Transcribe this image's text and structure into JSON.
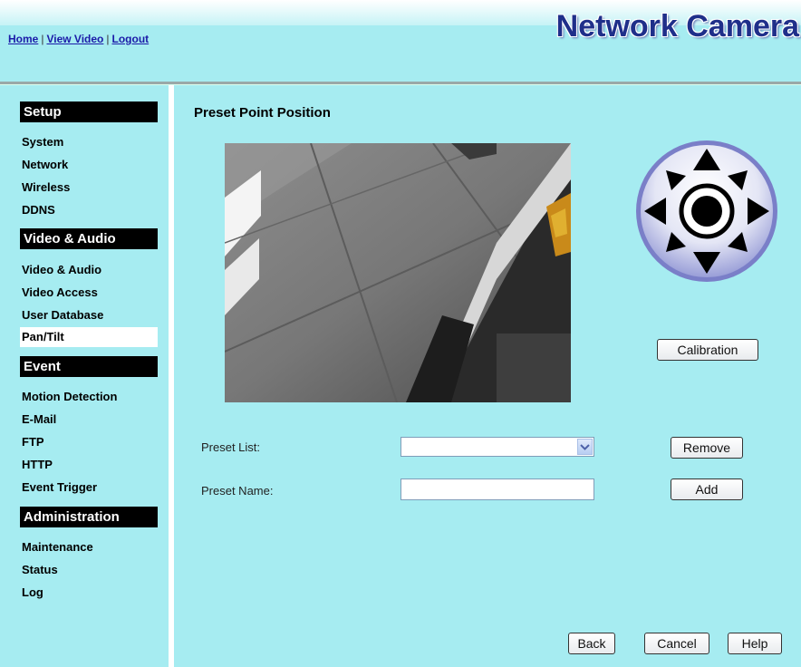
{
  "nav_links": {
    "home": "Home",
    "view_video": "View Video",
    "logout": "Logout",
    "separator": "|"
  },
  "brand": "Network Camera",
  "sidebar": {
    "sections": [
      {
        "title": "Setup",
        "items": [
          "System",
          "Network",
          "Wireless",
          "DDNS"
        ]
      },
      {
        "title": "Video & Audio",
        "items": [
          "Video & Audio",
          "Video Access",
          "User Database",
          "Pan/Tilt"
        ]
      },
      {
        "title": "Event",
        "items": [
          "Motion Detection",
          "E-Mail",
          "FTP",
          "HTTP",
          "Event Trigger"
        ]
      },
      {
        "title": "Administration",
        "items": [
          "Maintenance",
          "Status",
          "Log"
        ]
      }
    ],
    "active_item": "Pan/Tilt"
  },
  "main": {
    "title": "Preset Point Position",
    "calibration_button": "Calibration",
    "preset_list_label": "Preset List:",
    "preset_list_value": "",
    "remove_button": "Remove",
    "preset_name_label": "Preset Name:",
    "preset_name_value": "",
    "add_button": "Add"
  },
  "footer_buttons": {
    "back": "Back",
    "cancel": "Cancel",
    "help": "Help"
  },
  "colors": {
    "background": "#a6ecf1",
    "brand": "#1f2f8a",
    "link": "#1b1ba8",
    "section_header": "#000000"
  }
}
